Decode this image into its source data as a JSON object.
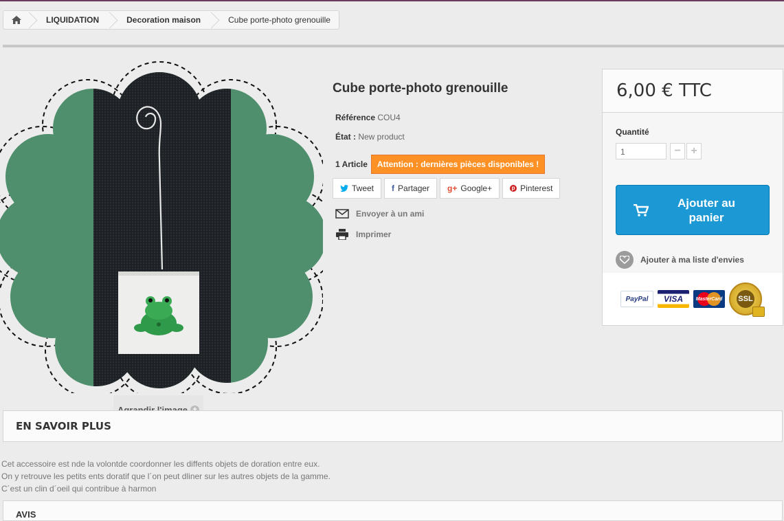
{
  "breadcrumb": {
    "items": [
      "LIQUIDATION",
      "Decoration maison"
    ],
    "current": "Cube porte-photo grenouille"
  },
  "product": {
    "title": "Cube porte-photo grenouille",
    "reference_label": "Référence",
    "reference_value": "COU4",
    "state_label": "État :",
    "state_value": "New product",
    "stock_count": "1 Article",
    "stock_warning": "Attention : dernières pièces disponibles !",
    "enlarge_label": "Agrandir l'image"
  },
  "social": {
    "tweet": "Tweet",
    "share": "Partager",
    "google": "Google+",
    "pinterest": "Pinterest"
  },
  "actions": {
    "send_friend": "Envoyer à un ami",
    "print": "Imprimer"
  },
  "buybox": {
    "price": "6,00 € TTC",
    "quantity_label": "Quantité",
    "quantity_value": "1",
    "add_to_cart_line1": "Ajouter au",
    "add_to_cart_line2": "panier",
    "wishlist": "Ajouter à ma liste d'envies",
    "payment_logos": [
      "PayPal",
      "VISA",
      "MasterCard",
      "SSL"
    ]
  },
  "more_info": {
    "heading": "EN SAVOIR PLUS",
    "lines": [
      "Cet accessoire est nde la volontde coordonner les diffents objets de doration entre eux.",
      "On y retrouve les petits ents doratif que l´on peut dliner sur les autres objets de la gamme.",
      "C´est un clin d´oeil qui contribue à harmon"
    ]
  },
  "reviews": {
    "heading": "AVIS"
  },
  "colors": {
    "accent": "#1c98d5",
    "warning": "#fe9126",
    "image_green": "#4f8f6d"
  }
}
